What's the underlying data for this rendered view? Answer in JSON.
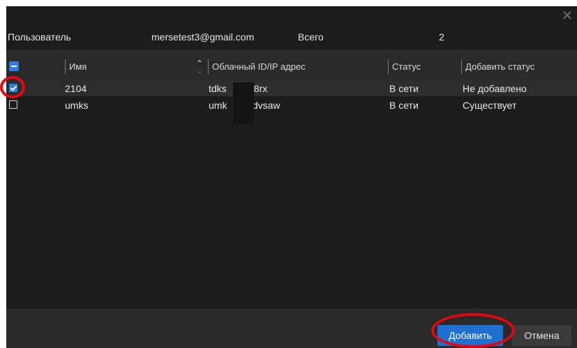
{
  "info": {
    "user_label": "Пользователь",
    "email": "mersetest3@gmail.com",
    "total_label": "Всего",
    "total_value": "2"
  },
  "table": {
    "columns": [
      "Имя",
      "Облачный ID/IP адрес",
      "Статус",
      "Добавить статус"
    ],
    "rows": [
      {
        "checked": true,
        "name": "2104",
        "cloud_id": "tdks",
        "cloud_id_tail": "68rx",
        "status": "В сети",
        "add_status": "Не добавлено"
      },
      {
        "checked": false,
        "name": "umks",
        "cloud_id": "umk",
        "cloud_id_tail": "odvsaw",
        "status": "В сети",
        "add_status": "Существует"
      }
    ]
  },
  "footer": {
    "add_label": "Добавить",
    "cancel_label": "Отмена"
  },
  "icons": {
    "close": "close-icon",
    "sort": "sort-icon",
    "header_checkbox": "partial-checkbox-icon"
  },
  "colors": {
    "accent": "#1f6fd1",
    "annotation": "#e30613",
    "background": "#1c1c1c"
  }
}
